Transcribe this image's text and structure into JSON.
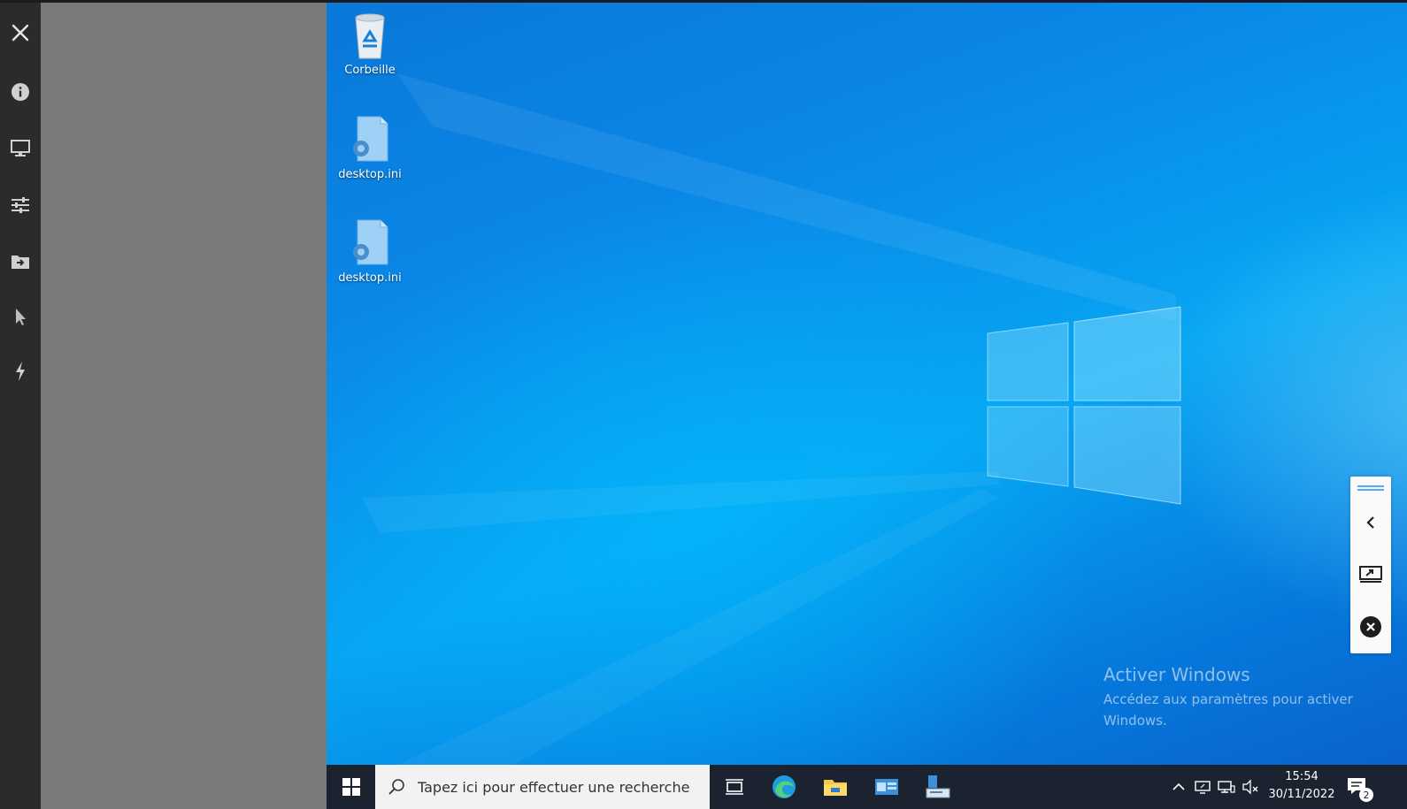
{
  "toolbar": {
    "items": [
      {
        "name": "close",
        "icon": "close-icon"
      },
      {
        "name": "info",
        "icon": "info-icon"
      },
      {
        "name": "display",
        "icon": "monitor-icon"
      },
      {
        "name": "settings",
        "icon": "sliders-icon"
      },
      {
        "name": "file-transfer",
        "icon": "folder-arrow-icon"
      },
      {
        "name": "pointer",
        "icon": "cursor-icon"
      },
      {
        "name": "actions",
        "icon": "lightning-icon"
      }
    ]
  },
  "desktop": {
    "icons": [
      {
        "label": "Corbeille",
        "icon": "recycle-bin-icon"
      },
      {
        "label": "desktop.ini",
        "icon": "settings-file-icon"
      },
      {
        "label": "desktop.ini",
        "icon": "settings-file-icon"
      }
    ],
    "watermark": {
      "title": "Activer Windows",
      "subtitle": "Accédez aux paramètres pour activer Windows."
    }
  },
  "floating_panel": {
    "items": [
      "drag-handle-icon",
      "chevron-left-icon",
      "screen-share-icon",
      "close-circle-icon"
    ]
  },
  "taskbar": {
    "search_placeholder": "Tapez ici pour effectuer une recherche",
    "apps": [
      "task-view-icon",
      "edge-icon",
      "file-explorer-icon",
      "server-manager-icon",
      "network-app-icon"
    ],
    "tray": [
      "chevron-up-icon",
      "display-settings-icon",
      "network-icon",
      "volume-muted-icon"
    ],
    "time": "15:54",
    "date": "30/11/2022",
    "notification_count": "2"
  },
  "colors": {
    "desktop_blue": "#0a86e6",
    "taskbar": "#1b2230",
    "toolbar": "#2b2b2b",
    "gray_pane": "#7a7a7a"
  }
}
